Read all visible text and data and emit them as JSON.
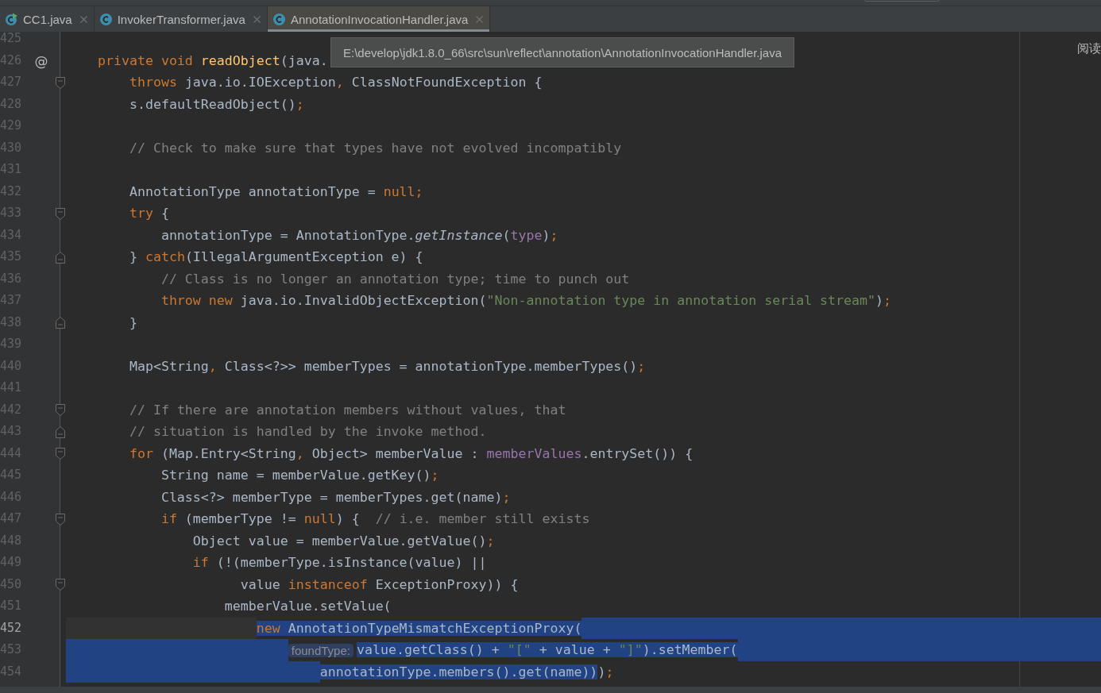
{
  "tabs": [
    {
      "label": "CC1.java",
      "kind": "runnable",
      "selected": false
    },
    {
      "label": "InvokerTransformer.java",
      "kind": "class",
      "selected": false
    },
    {
      "label": "AnnotationInvocationHandler.java",
      "kind": "class",
      "selected": true
    }
  ],
  "tooltip": "E:\\develop\\jdk1.8.0_66\\src\\sun\\reflect\\annotation\\AnnotationInvocationHandler.java",
  "side_label": "阅读",
  "lines": [
    {
      "num": "425",
      "kind": "plain",
      "current": false
    },
    {
      "num": "426",
      "kind": "plain",
      "current": false,
      "gutter_mark": "@",
      "tokens": [
        {
          "kind": "kw",
          "text": "    private void "
        },
        {
          "kind": "decl",
          "text": "readObject"
        },
        {
          "kind": "plain",
          "text": "(java."
        }
      ]
    },
    {
      "num": "427",
      "kind": "opener",
      "current": false,
      "tokens": [
        {
          "kind": "kw",
          "text": "        throws"
        },
        {
          "kind": "plain",
          "text": " java.io.IOException"
        },
        {
          "kind": "kw",
          "text": ","
        },
        {
          "kind": "plain",
          "text": " ClassNotFoundException {"
        }
      ]
    },
    {
      "num": "428",
      "kind": "plain",
      "current": false,
      "tokens": [
        {
          "kind": "plain",
          "text": "        s.defaultReadObject()"
        },
        {
          "kind": "kw",
          "text": ";"
        }
      ]
    },
    {
      "num": "429",
      "kind": "plain",
      "current": false
    },
    {
      "num": "430",
      "kind": "plain",
      "current": false,
      "tokens": [
        {
          "kind": "comment",
          "text": "        // Check to make sure that types have not evolved incompatibly"
        }
      ]
    },
    {
      "num": "431",
      "kind": "plain",
      "current": false
    },
    {
      "num": "432",
      "kind": "plain",
      "current": false,
      "tokens": [
        {
          "kind": "plain",
          "text": "        AnnotationType annotationType = "
        },
        {
          "kind": "kw",
          "text": "null;"
        }
      ]
    },
    {
      "num": "433",
      "kind": "opener",
      "current": false,
      "tokens": [
        {
          "kind": "kw",
          "text": "        try"
        },
        {
          "kind": "plain",
          "text": " {"
        }
      ]
    },
    {
      "num": "434",
      "kind": "plain",
      "current": false,
      "tokens": [
        {
          "kind": "plain",
          "text": "            annotationType = AnnotationType."
        },
        {
          "kind": "static",
          "text": "getInstance"
        },
        {
          "kind": "plain",
          "text": "("
        },
        {
          "kind": "field",
          "text": "type"
        },
        {
          "kind": "plain",
          "text": ")"
        },
        {
          "kind": "kw",
          "text": ";"
        }
      ]
    },
    {
      "num": "435",
      "kind": "closer",
      "current": false,
      "tokens": [
        {
          "kind": "plain",
          "text": "        } "
        },
        {
          "kind": "kw",
          "text": "catch"
        },
        {
          "kind": "plain",
          "text": "(IllegalArgumentException e) {"
        }
      ]
    },
    {
      "num": "436",
      "kind": "plain",
      "current": false,
      "tokens": [
        {
          "kind": "comment",
          "text": "            // Class is no longer an annotation type; time to punch out"
        }
      ]
    },
    {
      "num": "437",
      "kind": "plain",
      "current": false,
      "tokens": [
        {
          "kind": "kw",
          "text": "            throw new"
        },
        {
          "kind": "plain",
          "text": " java.io.InvalidObjectException("
        },
        {
          "kind": "str",
          "text": "\"Non-annotation type in annotation serial stream\""
        },
        {
          "kind": "plain",
          "text": ")"
        },
        {
          "kind": "kw",
          "text": ";"
        }
      ]
    },
    {
      "num": "438",
      "kind": "closer",
      "current": false,
      "tokens": [
        {
          "kind": "plain",
          "text": "        }"
        }
      ]
    },
    {
      "num": "439",
      "kind": "plain",
      "current": false
    },
    {
      "num": "440",
      "kind": "plain",
      "current": false,
      "tokens": [
        {
          "kind": "plain",
          "text": "        Map<String"
        },
        {
          "kind": "kw",
          "text": ","
        },
        {
          "kind": "plain",
          "text": " Class<?>> memberTypes = annotationType.memberTypes()"
        },
        {
          "kind": "kw",
          "text": ";"
        }
      ]
    },
    {
      "num": "441",
      "kind": "plain",
      "current": false
    },
    {
      "num": "442",
      "kind": "opener",
      "current": false,
      "tokens": [
        {
          "kind": "comment",
          "text": "        // If there are annotation members without values, that"
        }
      ]
    },
    {
      "num": "443",
      "kind": "closer",
      "current": false,
      "tokens": [
        {
          "kind": "comment",
          "text": "        // situation is handled by the invoke method."
        }
      ]
    },
    {
      "num": "444",
      "kind": "opener",
      "current": false,
      "tokens": [
        {
          "kind": "kw",
          "text": "        for"
        },
        {
          "kind": "plain",
          "text": " (Map.Entry<String"
        },
        {
          "kind": "kw",
          "text": ","
        },
        {
          "kind": "plain",
          "text": " Object> memberValue : "
        },
        {
          "kind": "field",
          "text": "memberValues"
        },
        {
          "kind": "plain",
          "text": ".entrySet()) {"
        }
      ]
    },
    {
      "num": "445",
      "kind": "plain",
      "current": false,
      "tokens": [
        {
          "kind": "plain",
          "text": "            String name = memberValue.getKey()"
        },
        {
          "kind": "kw",
          "text": ";"
        }
      ]
    },
    {
      "num": "446",
      "kind": "plain",
      "current": false,
      "tokens": [
        {
          "kind": "plain",
          "text": "            Class<?> memberType = memberTypes.get(name)"
        },
        {
          "kind": "kw",
          "text": ";"
        }
      ]
    },
    {
      "num": "447",
      "kind": "opener",
      "current": false,
      "tokens": [
        {
          "kind": "kw",
          "text": "            if"
        },
        {
          "kind": "plain",
          "text": " (memberType != "
        },
        {
          "kind": "kw",
          "text": "null"
        },
        {
          "kind": "plain",
          "text": ") {  "
        },
        {
          "kind": "comment",
          "text": "// i.e. member still exists"
        }
      ]
    },
    {
      "num": "448",
      "kind": "plain",
      "current": false,
      "tokens": [
        {
          "kind": "plain",
          "text": "                Object value = memberValue.getValue()"
        },
        {
          "kind": "kw",
          "text": ";"
        }
      ]
    },
    {
      "num": "449",
      "kind": "plain",
      "current": false,
      "tokens": [
        {
          "kind": "kw",
          "text": "                if"
        },
        {
          "kind": "plain",
          "text": " (!(memberType.isInstance(value) ||"
        }
      ]
    },
    {
      "num": "450",
      "kind": "opener",
      "current": false,
      "tokens": [
        {
          "kind": "plain",
          "text": "                      value "
        },
        {
          "kind": "kw",
          "text": "instanceof"
        },
        {
          "kind": "plain",
          "text": " ExceptionProxy)) {"
        }
      ]
    },
    {
      "num": "451",
      "kind": "plain",
      "current": false,
      "tokens": [
        {
          "kind": "plain",
          "text": "                    memberValue.setValue("
        }
      ]
    },
    {
      "num": "452",
      "kind": "plain",
      "current": true,
      "tokens": [
        {
          "kind": "kw",
          "text": "                        new",
          "selected": true
        },
        {
          "kind": "plain",
          "text": " AnnotationTypeMismatchExceptionProxy(",
          "selected": true
        }
      ]
    },
    {
      "num": "453",
      "kind": "plain",
      "current": false,
      "tokens": [
        {
          "kind": "plain",
          "hint": "foundType:",
          "text": "                            value.getClass() + ",
          "selected": true
        },
        {
          "kind": "str",
          "text": "\"[\"",
          "selected": true
        },
        {
          "kind": "plain",
          "text": " + value + ",
          "selected": true
        },
        {
          "kind": "str",
          "text": "\"]\"",
          "selected": true
        },
        {
          "kind": "plain",
          "text": ").setMember(",
          "selected": true
        }
      ]
    },
    {
      "num": "454",
      "kind": "plain",
      "current": false,
      "tokens": [
        {
          "kind": "plain",
          "text": "                                annotationType.members().get(name))",
          "selected": true
        },
        {
          "kind": "plain",
          "text": ")",
          "selected": false
        },
        {
          "kind": "kw",
          "text": ";",
          "selected": false
        }
      ]
    }
  ]
}
